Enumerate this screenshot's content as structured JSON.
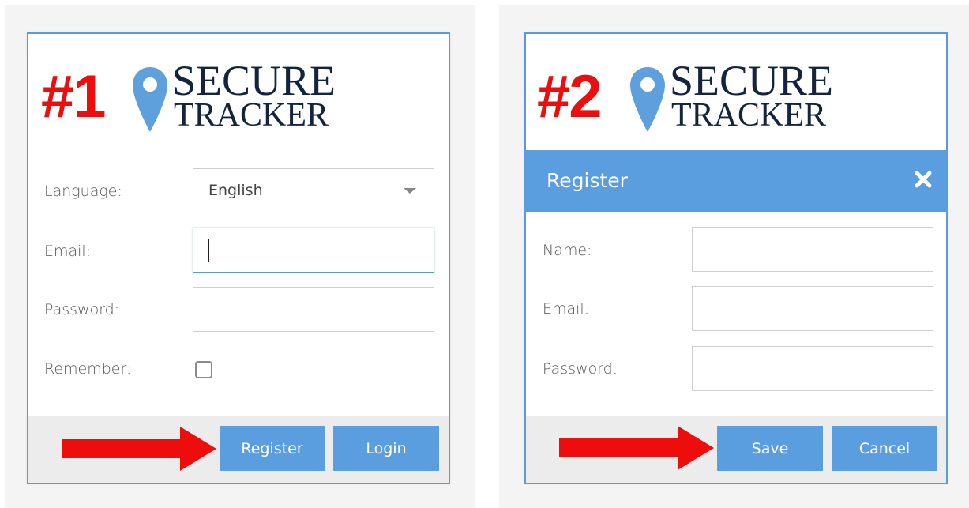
{
  "panel1": {
    "step_number": "#1",
    "brand_top": "SECURE",
    "brand_bottom": "TRACKER",
    "language_label": "Language:",
    "language_value": "English",
    "email_label": "Email:",
    "password_label": "Password:",
    "remember_label": "Remember:",
    "register_button": "Register",
    "login_button": "Login"
  },
  "panel2": {
    "step_number": "#2",
    "brand_top": "SECURE",
    "brand_bottom": "TRACKER",
    "dialog_title": "Register",
    "name_label": "Name:",
    "email_label": "Email:",
    "password_label": "Password:",
    "save_button": "Save",
    "cancel_button": "Cancel"
  },
  "colors": {
    "accent": "#5b9ee0",
    "annotation_red": "#ee0d0d",
    "brand_navy": "#14243f"
  },
  "icons": {
    "pin": "map-pin-icon",
    "close": "close-icon",
    "dropdown": "chevron-down-icon",
    "arrow": "arrow-right-icon"
  }
}
